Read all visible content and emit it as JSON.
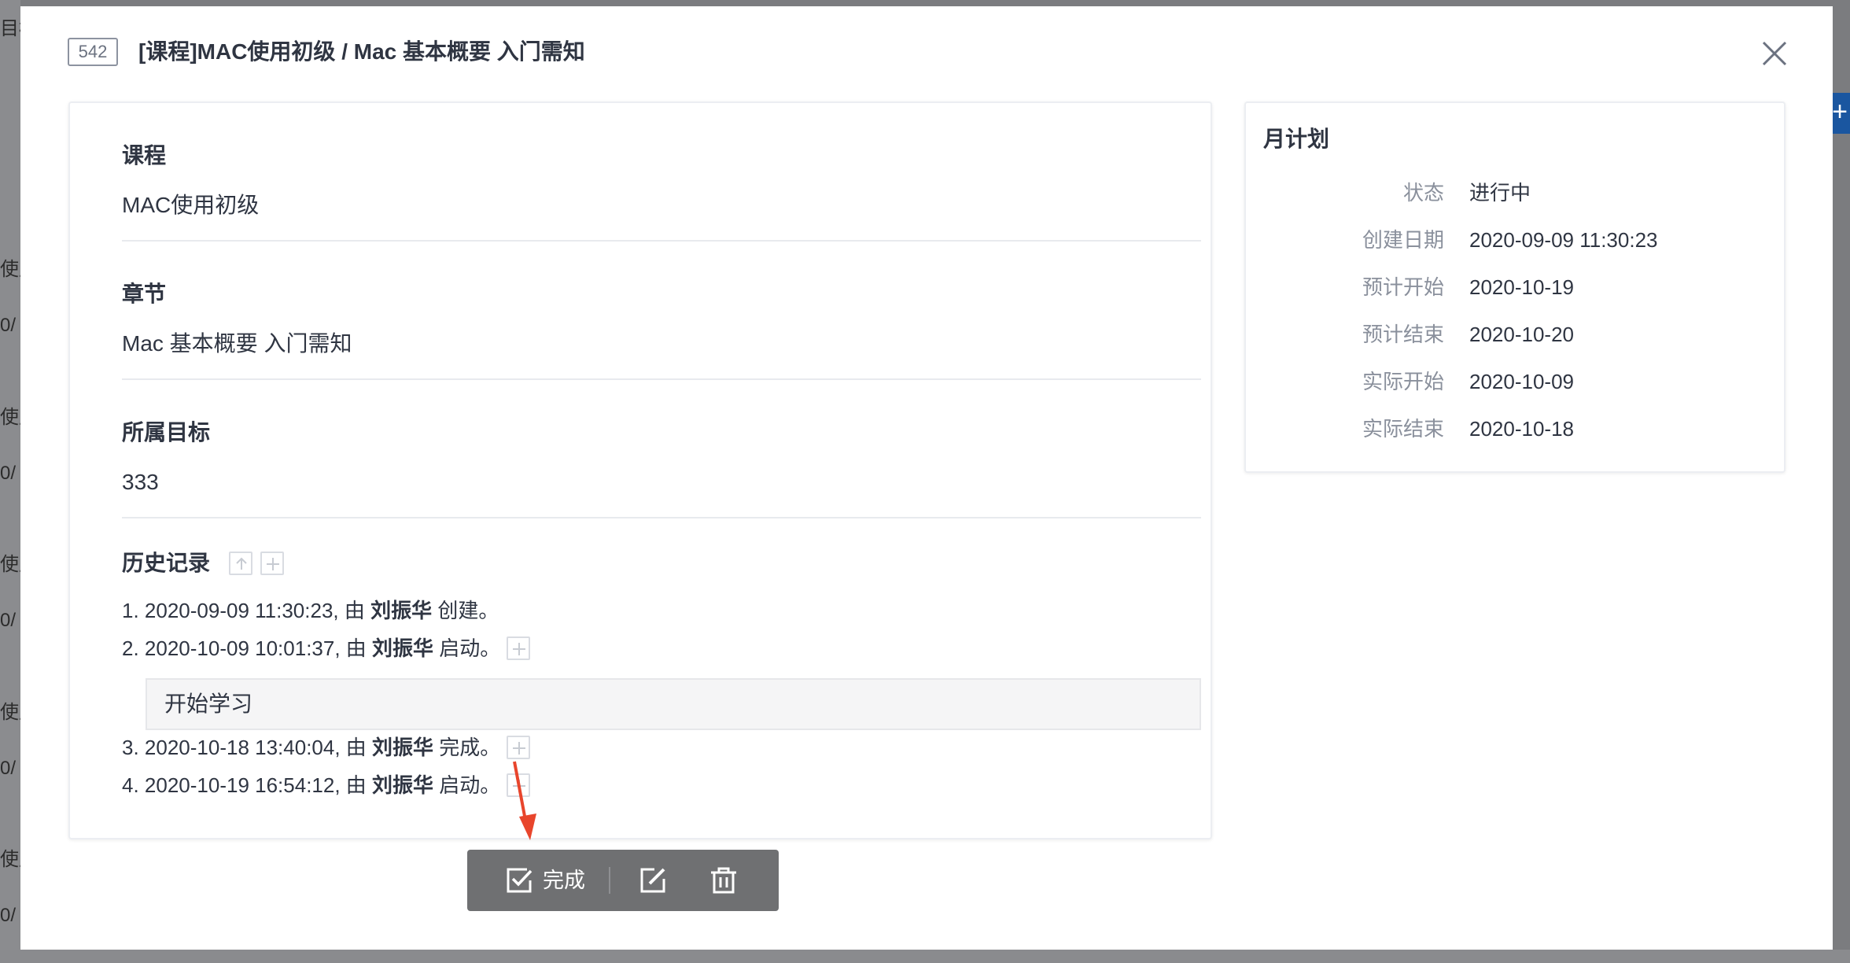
{
  "backdrop": {
    "fragments": [
      "目标",
      "使用",
      "0/",
      "使用",
      "0/",
      "使用",
      "0/",
      "使用",
      "0/",
      "使用",
      "0/"
    ],
    "plus": "+"
  },
  "modal": {
    "id": "542",
    "title": "[课程]MAC使用初级 / Mac 基本概要 入门需知"
  },
  "fields": [
    {
      "label": "课程",
      "value": "MAC使用初级"
    },
    {
      "label": "章节",
      "value": "Mac 基本概要 入门需知"
    },
    {
      "label": "所属目标",
      "value": "333"
    }
  ],
  "history": {
    "title": "历史记录",
    "by": "由",
    "entries": [
      {
        "prefix": "1. 2020-09-09 11:30:23, ",
        "user": "刘振华",
        "action": " 创建。"
      },
      {
        "prefix": "2. 2020-10-09 10:01:37, ",
        "user": "刘振华",
        "action": " 启动。"
      },
      {
        "prefix": "3. 2020-10-18 13:40:04, ",
        "user": "刘振华",
        "action": " 完成。"
      },
      {
        "prefix": "4. 2020-10-19 16:54:12, ",
        "user": "刘振华",
        "action": " 启动。"
      }
    ],
    "comment": "开始学习"
  },
  "side": {
    "title": "月计划",
    "rows": [
      {
        "label": "状态",
        "value": "进行中"
      },
      {
        "label": "创建日期",
        "value": "2020-09-09 11:30:23"
      },
      {
        "label": "预计开始",
        "value": "2020-10-19"
      },
      {
        "label": "预计结束",
        "value": "2020-10-20"
      },
      {
        "label": "实际开始",
        "value": "2020-10-09"
      },
      {
        "label": "实际结束",
        "value": "2020-10-18"
      }
    ]
  },
  "toolbar": {
    "complete_label": "完成"
  },
  "colors": {
    "accent_arrow": "#e8452c",
    "toolbar_bg": "#6f7072"
  }
}
